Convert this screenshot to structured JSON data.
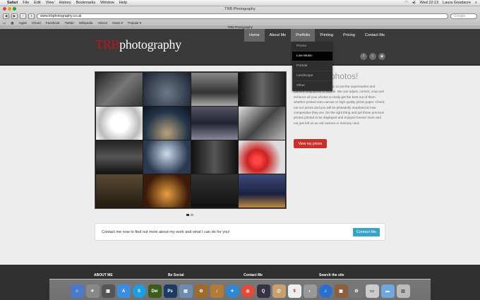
{
  "menubar": {
    "app": "Safari",
    "items": [
      "File",
      "Edit",
      "View",
      "History",
      "Bookmarks",
      "Window",
      "Help"
    ],
    "time": "Wed 22:13",
    "user": "Laura Goodacre"
  },
  "browser": {
    "window_title": "TRB Photography",
    "url": "www.trbphotography.co.uk",
    "search_placeholder": "Google",
    "bookmarks": [
      "Apple",
      "iCloud",
      "Facebook",
      "Twitter",
      "Wikipedia",
      "Yahoo!",
      "News ▾",
      "Popular ▾"
    ],
    "tab_title": "TRB Photography"
  },
  "site": {
    "logo_brand": "TRB",
    "logo_rest": "photography",
    "nav": [
      "Home",
      "About Me",
      "Portfolio",
      "Printing",
      "Pricing",
      "Contact Me"
    ],
    "active_nav": "Home",
    "dropdown": [
      "Promo",
      "Live Music",
      "Portrait",
      "Landscape",
      "Other"
    ],
    "dropdown_highlight": "Live Music",
    "social_icons": [
      "facebook-icon",
      "twitter-icon",
      "rss-icon"
    ],
    "promo_heading": "ur photos!",
    "promo_text": "in wide format printing and a 12 put the supermarket and camera shop prints to shame. We can adjust, correct, crop and enhance all your photos to really get the best out of them whether printed onto canvas or high quality photo paper. Check out our prices and you will be pleasantly surprised at how competative they are. Do the right thing and get those precious photos printed to be displayed and enjoyed forever more and not just left on an old camera or memory card.",
    "price_button": "View my prices",
    "contact_text": "Contact me now to find out more about my work and what I can do for you!",
    "contact_button": "Contact Me",
    "footer_columns": [
      "ABOUT ME",
      "Be Social",
      "Contact Me",
      "Search the site"
    ]
  },
  "colors": {
    "accent_red": "#c8101e",
    "button_red": "#c9302c",
    "button_blue": "#36a3c7",
    "header_bg": "#3a3a3a"
  }
}
